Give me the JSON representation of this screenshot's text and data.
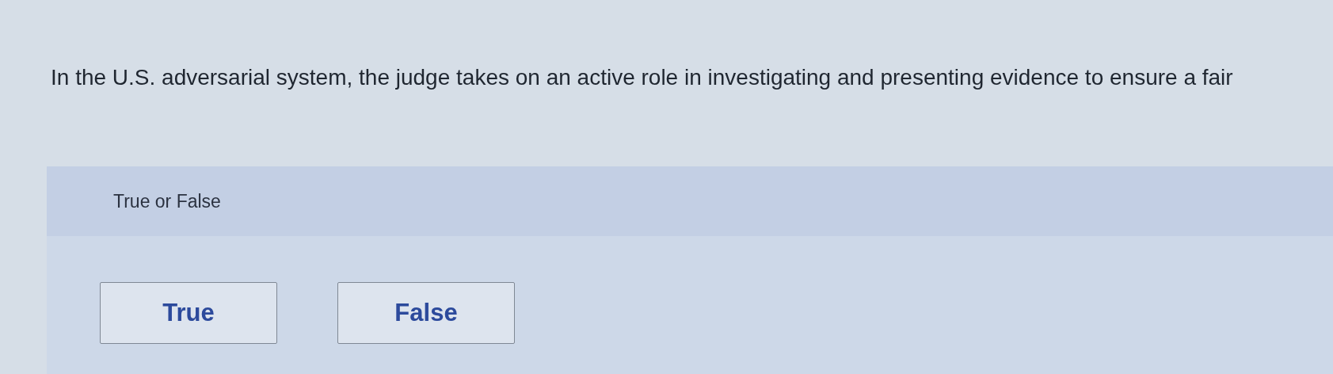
{
  "question": "In the U.S. adversarial system, the judge takes on an active role in investigating and presenting evidence to ensure a fair",
  "prompt": "True or False",
  "options": [
    {
      "label": "True",
      "selected": false
    },
    {
      "label": "False",
      "selected": false
    }
  ]
}
